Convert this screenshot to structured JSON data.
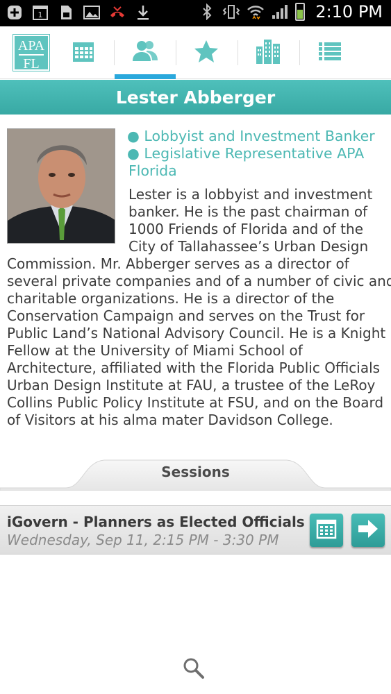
{
  "status_bar": {
    "time": "2:10 PM",
    "icons": [
      "add-icon",
      "calendar-day-icon",
      "sd-card-icon",
      "image-icon",
      "missed-call-icon",
      "download-icon",
      "bluetooth-icon",
      "vibrate-icon",
      "wifi-icon",
      "signal-icon",
      "battery-icon"
    ],
    "calendar_day": "1"
  },
  "tabs": [
    {
      "name": "logo",
      "icon": "apa-fl-logo"
    },
    {
      "name": "schedule",
      "icon": "calendar-icon"
    },
    {
      "name": "speakers",
      "icon": "people-icon",
      "active": true
    },
    {
      "name": "favorites",
      "icon": "star-icon"
    },
    {
      "name": "exhibitors",
      "icon": "buildings-icon"
    },
    {
      "name": "list",
      "icon": "list-icon"
    }
  ],
  "logo": {
    "line1": "APA",
    "line2": "FL"
  },
  "accent_color": "#4cb8b3",
  "active_tab_indicator_color": "#2aa8dc",
  "speaker": {
    "name": "Lester Abberger",
    "roles": [
      "Lobbyist and Investment Banker",
      "Legislative Representative APA",
      "Florida"
    ],
    "bio_lines": [
      "Lester is a lobbyist and investment",
      "banker. He is the past chairman of",
      "1000 Friends of Florida and of the",
      "City of Tallahassee’s Urban Design",
      "Commission. Mr. Abberger serves as a director of",
      "several private companies and of a number of civic and",
      "charitable organizations. He is a director of the",
      "Conservation Campaign and serves on the Trust for",
      "Public Land’s National Advisory Council. He is a Knight",
      "Fellow at the University of Miami School of",
      "Architecture, affiliated with the Florida Public Officials",
      "Urban Design Institute at FAU, a trustee of the LeRoy",
      "Collins Public Policy Institute at FSU, and on the Board",
      "of Visitors at his alma mater Davidson College."
    ]
  },
  "sessions": {
    "label": "Sessions",
    "items": [
      {
        "title": "iGovern - Planners as Elected Officials",
        "time": "Wednesday, Sep 11, 2:15 PM - 3:30 PM"
      }
    ]
  },
  "footer": {
    "icon": "search-icon"
  }
}
